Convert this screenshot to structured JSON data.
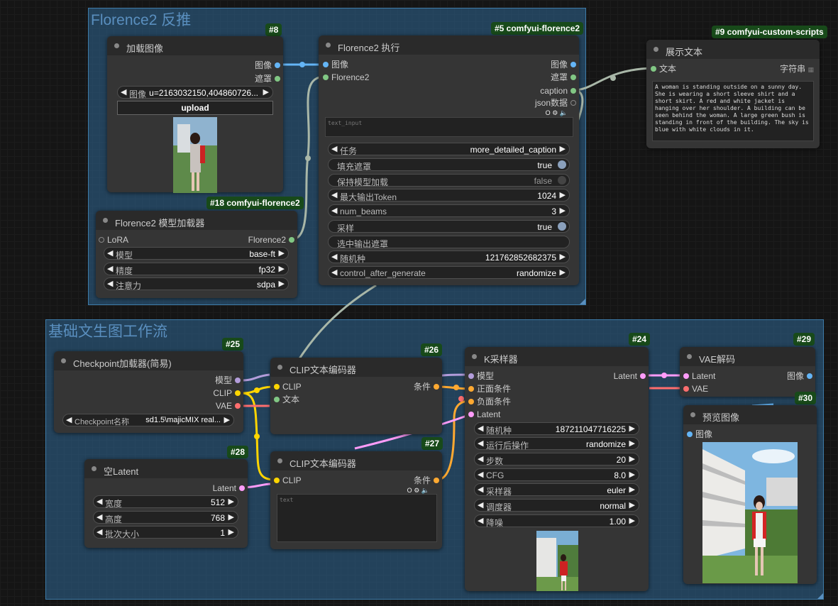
{
  "colors": {
    "image": "#64b5f6",
    "mask": "#81c784",
    "florence": "#81c784",
    "model": "#b39ddb",
    "clip": "#ffd500",
    "vae": "#ff6e6e",
    "conditioning": "#ffa931",
    "latent": "#ff9cf9",
    "string": "#81c784",
    "group_bg": "#306896",
    "badge_bg": "#184a1a"
  },
  "groups": {
    "florence": {
      "title": "Florence2 反推"
    },
    "basic": {
      "title": "基础文生图工作流"
    }
  },
  "nodes": {
    "load_image": {
      "badge": "#8",
      "title": "加载图像",
      "outputs": [
        "图像",
        "遮罩"
      ],
      "image_combo": {
        "name": "图像",
        "value": "u=2163032150,404860726..."
      },
      "upload_label": "upload"
    },
    "florence_exec": {
      "badge": "#5 comfyui-florence2",
      "title": "Florence2 执行",
      "inputs": [
        "图像",
        "Florence2"
      ],
      "outputs": [
        "图像",
        "遮罩",
        "caption",
        "json数据"
      ],
      "text_input_placeholder": "text_input",
      "widgets": {
        "task": {
          "name": "任务",
          "value": "more_detailed_caption"
        },
        "fill_mask": {
          "name": "填充遮罩",
          "value": "true"
        },
        "keep_model": {
          "name": "保持模型加载",
          "value": "false"
        },
        "max_tokens": {
          "name": "最大输出Token",
          "value": "1024"
        },
        "num_beams": {
          "name": "num_beams",
          "value": "3"
        },
        "sample": {
          "name": "采样",
          "value": "true"
        },
        "output_mask_select": {
          "name": "选中输出遮罩",
          "value": ""
        },
        "seed": {
          "name": "随机种",
          "value": "121762852682375"
        },
        "control_after": {
          "name": "control_after_generate",
          "value": "randomize"
        }
      }
    },
    "show_text": {
      "badge": "#9 comfyui-custom-scripts",
      "title": "展示文本",
      "input": "文本",
      "type_label": "字符串",
      "text": "A woman is standing outside on a sunny day. She is wearing a short sleeve shirt and a short skirt. A red and white jacket is hanging over her shoulder. A building can be seen behind the woman. A large green bush is standing in front of the building. The sky is blue with white clouds in it."
    },
    "florence_loader": {
      "badge": "#18 comfyui-florence2",
      "title": "Florence2 模型加载器",
      "input": "LoRA",
      "output": "Florence2",
      "widgets": {
        "model": {
          "name": "模型",
          "value": "base-ft"
        },
        "precision": {
          "name": "精度",
          "value": "fp32"
        },
        "attention": {
          "name": "注意力",
          "value": "sdpa"
        }
      }
    },
    "checkpoint": {
      "badge": "#25",
      "title": "Checkpoint加载器(简易)",
      "outputs": [
        "模型",
        "CLIP",
        "VAE"
      ],
      "ckpt": {
        "name": "Checkpoint名称",
        "value": "sd1.5\\majicMIX real..."
      }
    },
    "clip_pos": {
      "badge": "#26",
      "title": "CLIP文本编码器",
      "inputs": [
        "CLIP",
        "文本"
      ],
      "output": "条件"
    },
    "clip_neg": {
      "badge": "#27",
      "title": "CLIP文本编码器",
      "input": "CLIP",
      "output": "条件",
      "placeholder": "text"
    },
    "empty_latent": {
      "badge": "#28",
      "title": "空Latent",
      "output": "Latent",
      "widgets": {
        "width": {
          "name": "宽度",
          "value": "512"
        },
        "height": {
          "name": "高度",
          "value": "768"
        },
        "batch": {
          "name": "批次大小",
          "value": "1"
        }
      }
    },
    "ksampler": {
      "badge": "#24",
      "title": "K采样器",
      "inputs": [
        "模型",
        "正面条件",
        "负面条件",
        "Latent"
      ],
      "output": "Latent",
      "widgets": {
        "seed": {
          "name": "随机种",
          "value": "187211047716225"
        },
        "after": {
          "name": "运行后操作",
          "value": "randomize"
        },
        "steps": {
          "name": "步数",
          "value": "20"
        },
        "cfg": {
          "name": "CFG",
          "value": "8.0"
        },
        "sampler": {
          "name": "采样器",
          "value": "euler"
        },
        "scheduler": {
          "name": "调度器",
          "value": "normal"
        },
        "denoise": {
          "name": "降噪",
          "value": "1.00"
        }
      }
    },
    "vae_decode": {
      "badge": "#29",
      "title": "VAE解码",
      "inputs": [
        "Latent",
        "VAE"
      ],
      "output": "图像"
    },
    "preview": {
      "badge": "#30",
      "title": "预览图像",
      "input": "图像"
    }
  }
}
